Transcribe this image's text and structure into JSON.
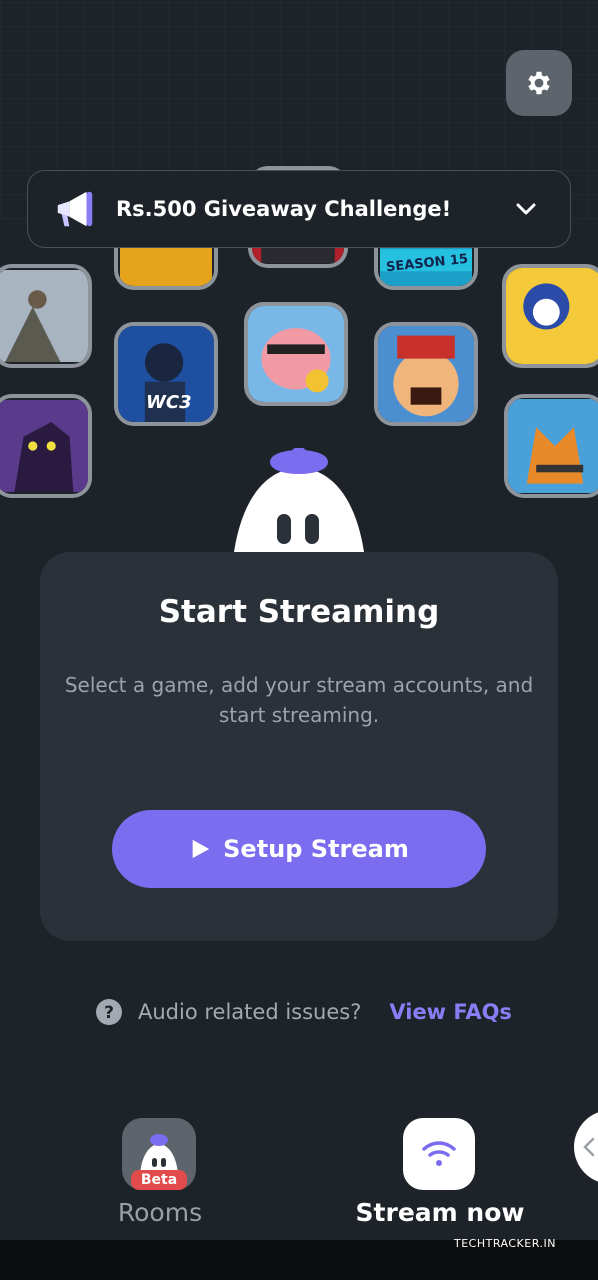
{
  "banner": {
    "text": "Rs.500 Giveaway Challenge!",
    "icon": "megaphone-icon",
    "expand_icon": "chevron-down-icon"
  },
  "settings": {
    "icon": "gear-icon"
  },
  "game_tiles": {
    "season_badge": "SEASON 15",
    "cricket_badge": "WC3"
  },
  "card": {
    "title": "Start Streaming",
    "description": "Select a game, add your stream accounts, and start streaming.",
    "button_label": "Setup Stream",
    "button_icon": "play-icon"
  },
  "faq": {
    "question": "Audio related issues?",
    "link": "View FAQs",
    "icon": "question-circle-icon"
  },
  "bottom_nav": {
    "rooms_label": "Rooms",
    "rooms_badge": "Beta",
    "stream_label": "Stream now",
    "stream_icon": "wifi-icon"
  },
  "watermark": "TECHTRACKER.IN",
  "colors": {
    "background": "#1e2329",
    "card": "#2b3138",
    "accent": "#7b6cf0",
    "link": "#8b7df5",
    "badge": "#e24b4b"
  }
}
